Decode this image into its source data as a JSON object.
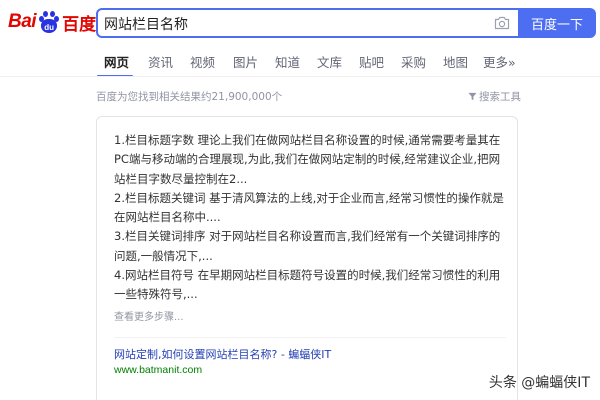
{
  "logo": {
    "part1": "Bai",
    "paw_text": "du",
    "part2": "百度"
  },
  "search": {
    "value": "网站栏目名称",
    "button_label": "百度一下"
  },
  "tabs": [
    {
      "label": "网页",
      "active": true
    },
    {
      "label": "资讯"
    },
    {
      "label": "视频"
    },
    {
      "label": "图片"
    },
    {
      "label": "知道"
    },
    {
      "label": "文库"
    },
    {
      "label": "贴吧"
    },
    {
      "label": "采购"
    },
    {
      "label": "地图"
    },
    {
      "label": "更多»"
    }
  ],
  "result_count": "百度为您找到相关结果约21,900,000个",
  "search_tools_label": "搜索工具",
  "card": {
    "items": [
      "1.栏目标题字数 理论上我们在做网站栏目名称设置的时候,通常需要考量其在PC端与移动端的合理展现,为此,我们在做网站定制的时候,经常建议企业,把网站栏目字数尽量控制在2...",
      "2.栏目标题关键词 基于清风算法的上线,对于企业而言,经常习惯性的操作就是在网站栏目名称中....",
      "3.栏目关键词排序 对于网站栏目名称设置而言,我们经常有一个关键词排序的问题,一般情况下,...",
      "4.网站栏目符号 在早期网站栏目标题符号设置的时候,我们经常习惯性的利用一些特殊符号,..."
    ],
    "more": "查看更多步骤...",
    "link_title": "网站定制,如何设置网站栏目名称? - 蝙蝠侠IT",
    "url": "www.batmanit.com"
  },
  "watermark": "头条 @蝙蝠侠IT",
  "colors": {
    "brand_blue": "#4e6ef2",
    "logo_red": "#e10602",
    "link_blue": "#2440b3",
    "url_green": "#008000"
  }
}
